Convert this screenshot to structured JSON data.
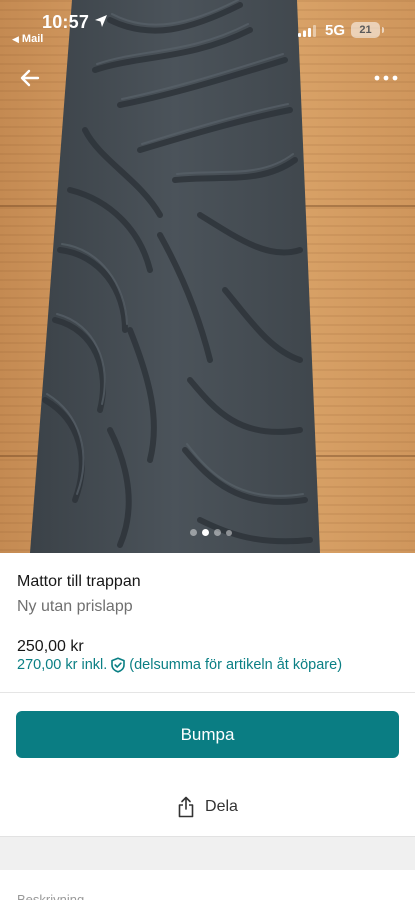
{
  "status_bar": {
    "time": "10:57",
    "back_app": "Mail",
    "network": "5G",
    "battery": "21"
  },
  "photo": {
    "carousel_total": 4,
    "carousel_active": 2
  },
  "listing": {
    "title": "Mattor till trappan",
    "condition": "Ny utan prislapp",
    "price": "250,00 kr",
    "price_incl": "270,00 kr inkl.",
    "price_incl_note": "(delsumma för artikeln åt köpare)"
  },
  "actions": {
    "bump_label": "Bumpa",
    "share_label": "Dela"
  },
  "description": {
    "heading": "Beskrivning"
  },
  "colors": {
    "accent": "#0a7d83",
    "accent_text": "#0a7f84",
    "rug": "#474f56",
    "floor": "#d59c62"
  }
}
